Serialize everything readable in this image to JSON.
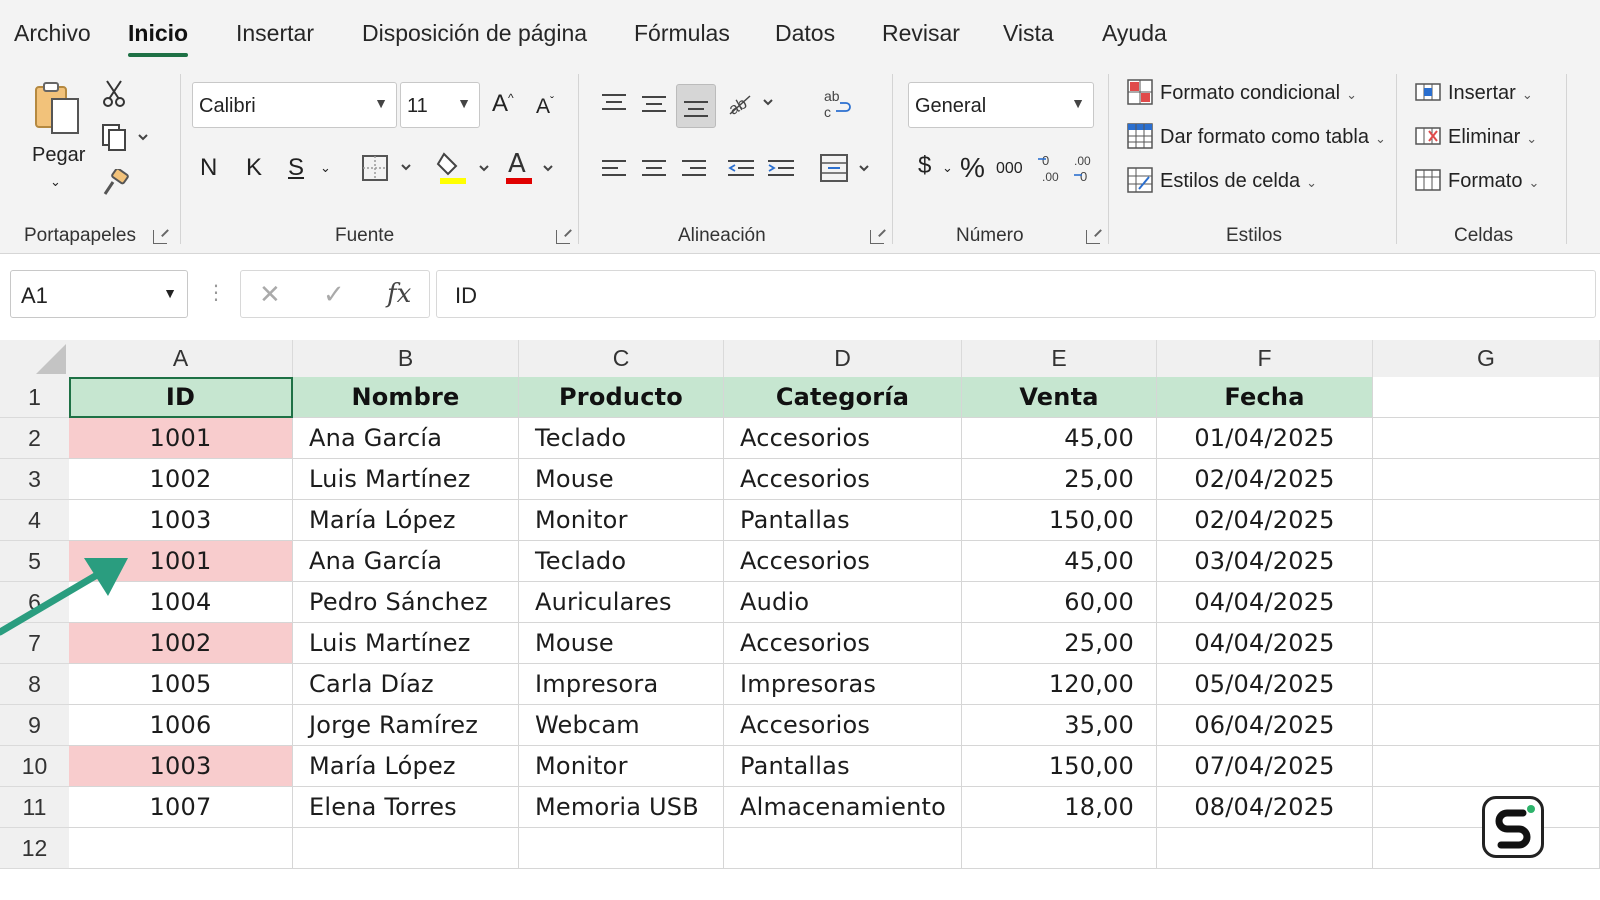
{
  "menu": [
    "Archivo",
    "Inicio",
    "Insertar",
    "Disposición de página",
    "Fórmulas",
    "Datos",
    "Revisar",
    "Vista",
    "Ayuda"
  ],
  "ribbon": {
    "clipboard": {
      "paste_label": "Pegar",
      "group_label": "Portapapeles"
    },
    "font": {
      "font_name": "Calibri",
      "font_size": "11",
      "bold": "N",
      "italic": "K",
      "underline": "S",
      "group_label": "Fuente",
      "fill_color": "#ffff00",
      "font_color": "#e00000"
    },
    "alignment": {
      "group_label": "Alineación"
    },
    "number": {
      "format": "General",
      "currency": "$",
      "percent": "%",
      "thousands": "000",
      "group_label": "Número"
    },
    "styles": {
      "conditional": "Formato condicional",
      "as_table": "Dar formato como tabla",
      "cell_styles": "Estilos de celda",
      "group_label": "Estilos"
    },
    "cells": {
      "insert": "Insertar",
      "delete": "Eliminar",
      "format": "Formato",
      "group_label": "Celdas"
    }
  },
  "formula_bar": {
    "name_box": "A1",
    "fx": "fx",
    "content": "ID"
  },
  "columns": [
    "A",
    "B",
    "C",
    "D",
    "E",
    "F",
    "G"
  ],
  "rows": [
    "1",
    "2",
    "3",
    "4",
    "5",
    "6",
    "7",
    "8",
    "9",
    "10",
    "11",
    "12"
  ],
  "table": {
    "headers": [
      "ID",
      "Nombre",
      "Producto",
      "Categoría",
      "Venta",
      "Fecha"
    ],
    "data": [
      [
        "1001",
        "Ana García",
        "Teclado",
        "Accesorios",
        "45,00",
        "01/04/2025"
      ],
      [
        "1002",
        "Luis Martínez",
        "Mouse",
        "Accesorios",
        "25,00",
        "02/04/2025"
      ],
      [
        "1003",
        "María López",
        "Monitor",
        "Pantallas",
        "150,00",
        "02/04/2025"
      ],
      [
        "1001",
        "Ana García",
        "Teclado",
        "Accesorios",
        "45,00",
        "03/04/2025"
      ],
      [
        "1004",
        "Pedro Sánchez",
        "Auriculares",
        "Audio",
        "60,00",
        "04/04/2025"
      ],
      [
        "1002",
        "Luis Martínez",
        "Mouse",
        "Accesorios",
        "25,00",
        "04/04/2025"
      ],
      [
        "1005",
        "Carla Díaz",
        "Impresora",
        "Impresoras",
        "120,00",
        "05/04/2025"
      ],
      [
        "1006",
        "Jorge Ramírez",
        "Webcam",
        "Accesorios",
        "35,00",
        "06/04/2025"
      ],
      [
        "1003",
        "María López",
        "Monitor",
        "Pantallas",
        "150,00",
        "07/04/2025"
      ],
      [
        "1007",
        "Elena Torres",
        "Memoria USB",
        "Almacenamiento",
        "18,00",
        "08/04/2025"
      ]
    ],
    "duplicate_rows": [
      0,
      3,
      5,
      8
    ],
    "header_color": "#c6e6d0",
    "duplicate_color": "#f8cccd"
  },
  "annotation": {
    "arrow_color": "#2a9d7f"
  }
}
